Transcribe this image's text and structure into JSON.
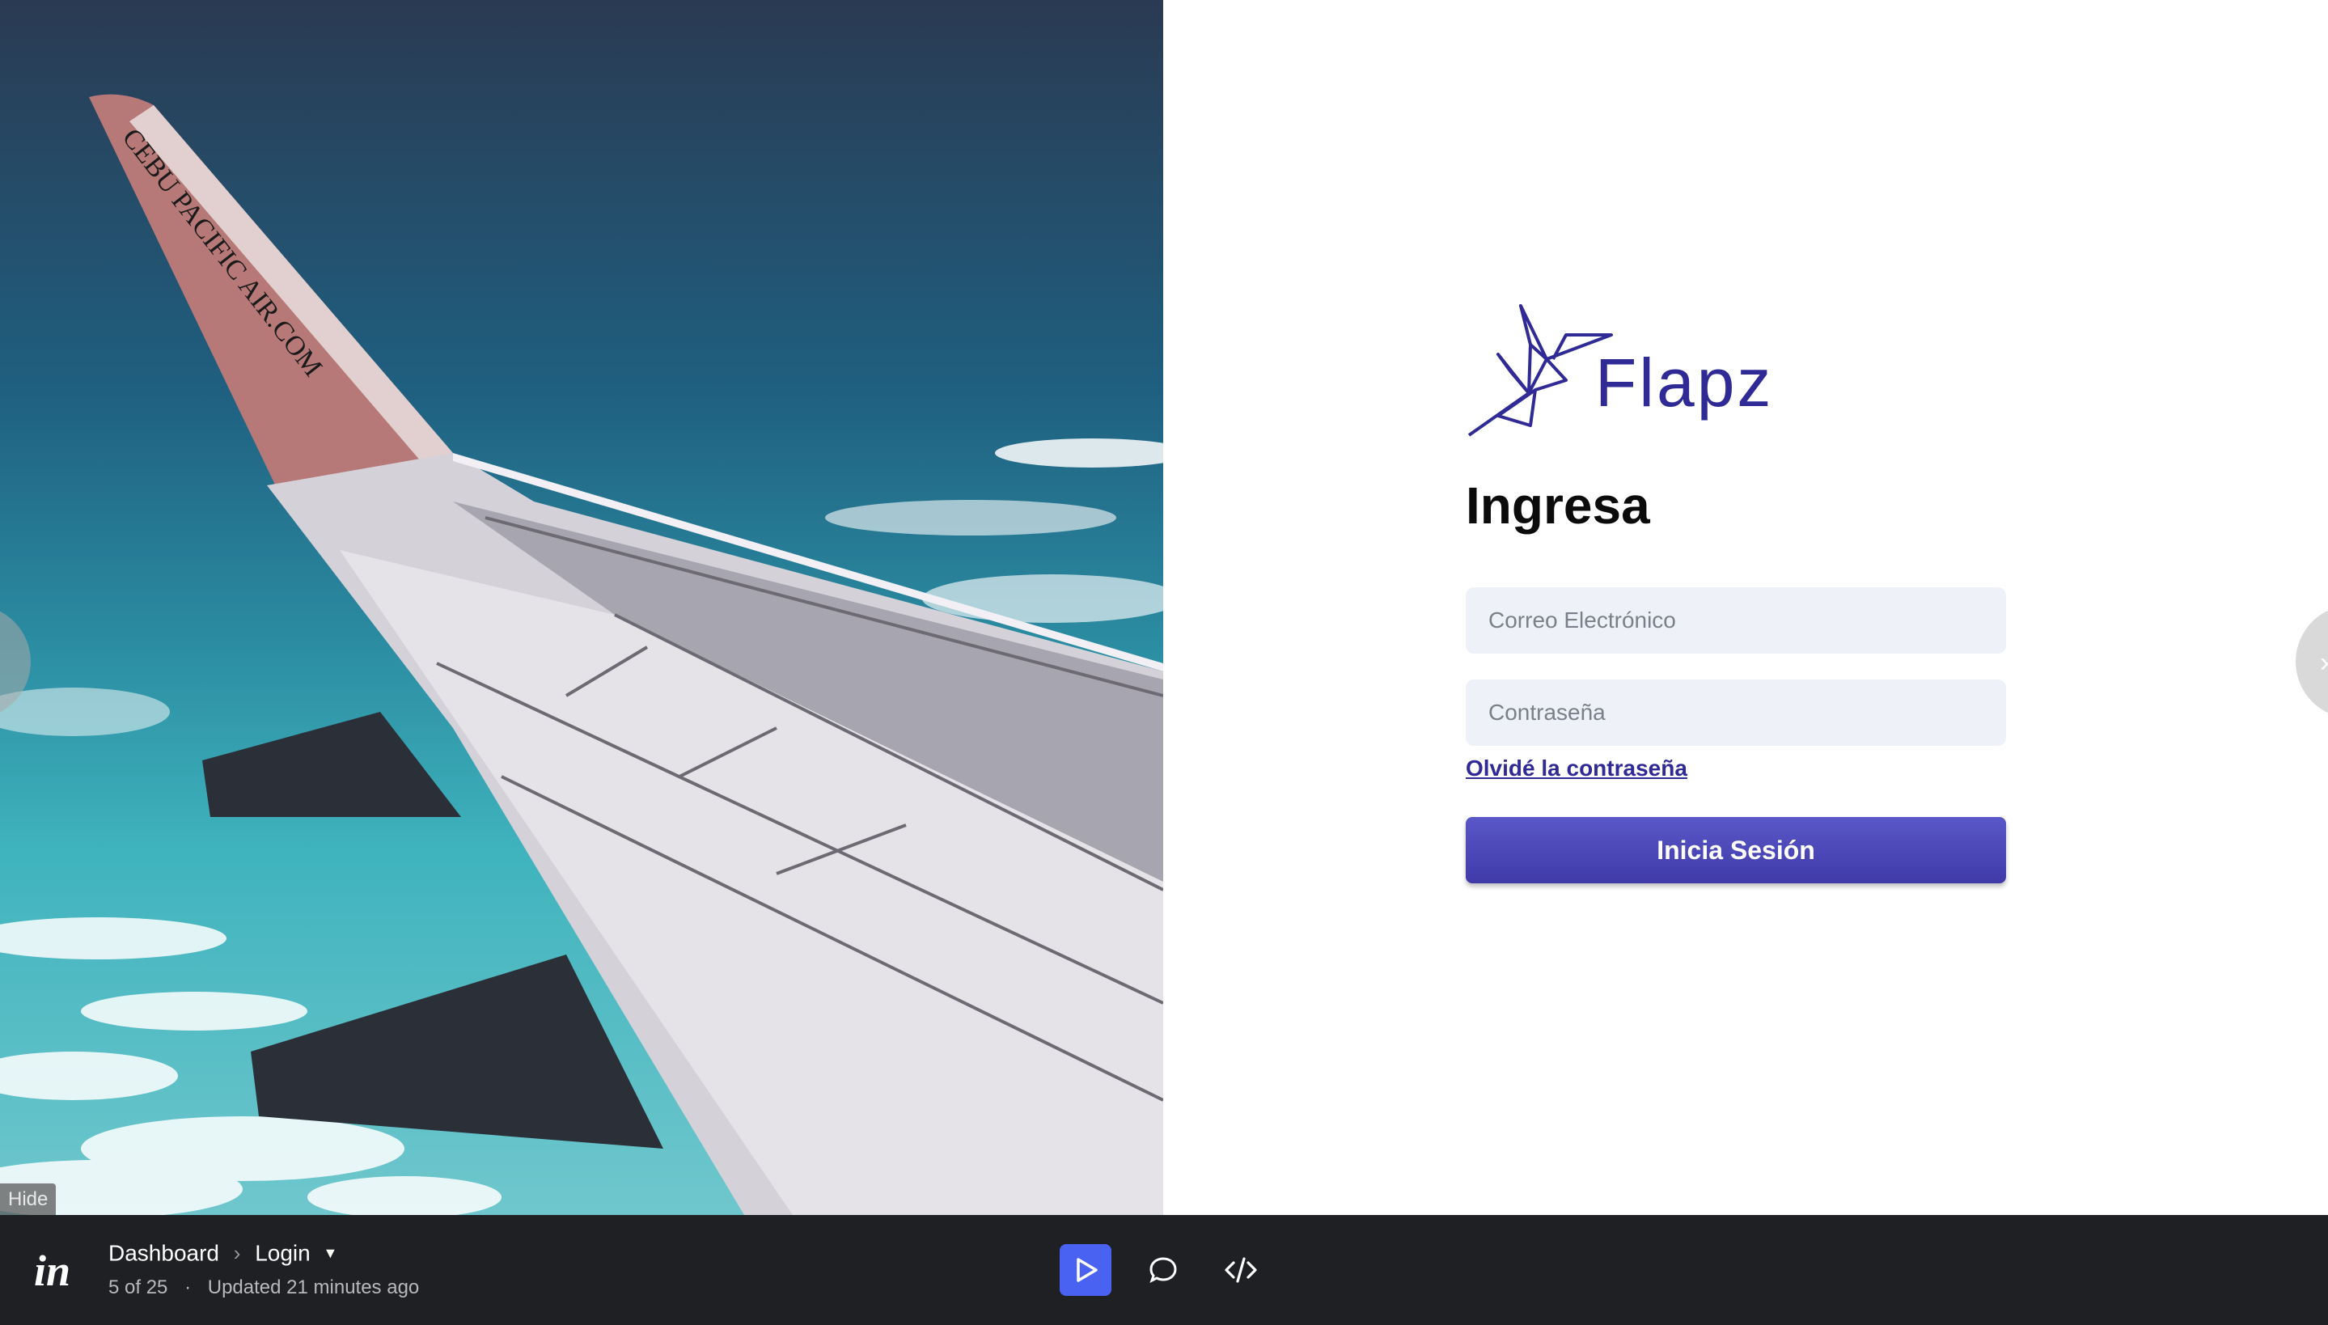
{
  "login": {
    "logo_text": "Flapz",
    "title": "Ingresa",
    "email_placeholder": "Correo Electrónico",
    "password_placeholder": "Contraseña",
    "forgot_link": "Olvidé la contraseña",
    "submit_label": "Inicia Sesión"
  },
  "hero": {
    "wing_text": "CEBU PACIFIC AIR.COM",
    "hide_label": "Hide"
  },
  "bar": {
    "breadcrumb_root": "Dashboard",
    "breadcrumb_current": "Login",
    "screen_position": "5 of 25",
    "updated": "Updated 21 minutes ago"
  },
  "colors": {
    "brand": "#2f2a96",
    "button": "#4a46b8",
    "input_bg": "#eef2f8",
    "bar_bg": "#1f2023",
    "play_active": "#4a62f2"
  },
  "icons": [
    "invision-logo-icon",
    "chevron-right-icon",
    "caret-down-icon",
    "play-icon",
    "comment-icon",
    "code-icon",
    "hummingbird-logo-icon"
  ]
}
